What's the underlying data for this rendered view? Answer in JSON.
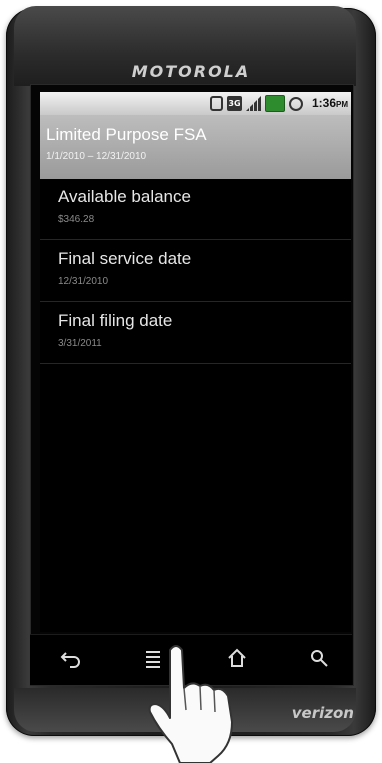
{
  "device": {
    "brand": "MOTOROLA",
    "carrier": "verizon"
  },
  "statusbar": {
    "time": "1:36",
    "ampm": "PM",
    "network_label": "3G"
  },
  "header": {
    "title": "Limited Purpose FSA",
    "subtitle": "1/1/2010 – 12/31/2010"
  },
  "details": [
    {
      "label": "Available balance",
      "value": "$346.28"
    },
    {
      "label": "Final service date",
      "value": "12/31/2010"
    },
    {
      "label": "Final filing date",
      "value": "3/31/2011"
    }
  ],
  "navbar": {
    "buttons": [
      "back-icon",
      "menu-icon",
      "home-icon",
      "search-icon"
    ]
  }
}
